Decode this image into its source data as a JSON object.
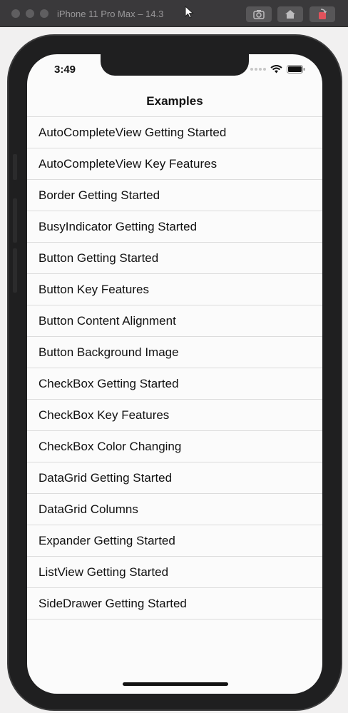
{
  "window": {
    "title": "iPhone 11 Pro Max – 14.3"
  },
  "toolbar": {
    "screenshot_icon": "camera-icon",
    "home_icon": "home-icon",
    "rotate_icon": "rotate-icon"
  },
  "status_bar": {
    "time": "3:49"
  },
  "nav": {
    "title": "Examples"
  },
  "examples": [
    "AutoCompleteView Getting Started",
    "AutoCompleteView Key Features",
    "Border Getting Started",
    "BusyIndicator Getting Started",
    "Button Getting Started",
    "Button Key Features",
    "Button Content Alignment",
    "Button Background Image",
    "CheckBox Getting Started",
    "CheckBox Key Features",
    "CheckBox Color Changing",
    "DataGrid Getting Started",
    "DataGrid Columns",
    "Expander Getting Started",
    "ListView Getting Started",
    "SideDrawer Getting Started"
  ]
}
